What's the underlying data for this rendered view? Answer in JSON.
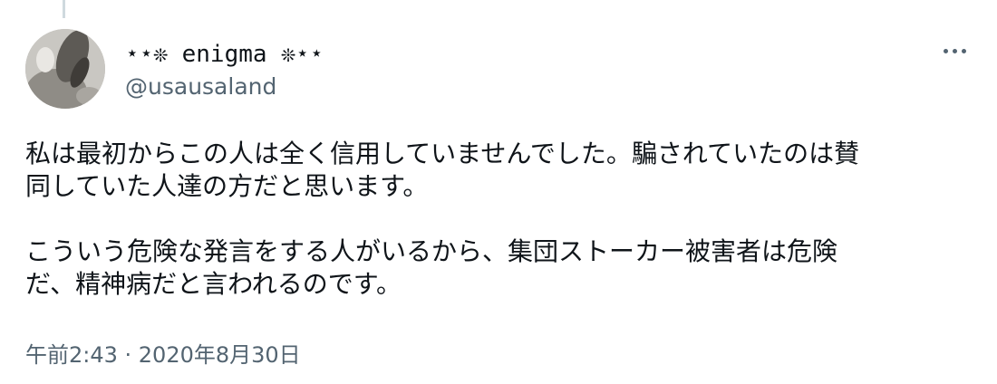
{
  "author": {
    "display_name": "⋆⋆❊ enigma ❊⋆⋆",
    "handle": "@usausaland"
  },
  "tweet": {
    "paragraphs": [
      "私は最初からこの人は全く信用していませんでした。騙されていたのは賛\n同していた人達の方だと思います。",
      "こういう危険な発言をする人がいるから、集団ストーカー被害者は危険\nだ、精神病だと言われるのです。"
    ],
    "timestamp": "午前2:43 · 2020年8月30日"
  },
  "icons": {
    "more": "more-horizontal-icon"
  },
  "colors": {
    "text_primary": "#0f1419",
    "text_secondary": "#536471",
    "thread_line": "#cfd9de"
  }
}
